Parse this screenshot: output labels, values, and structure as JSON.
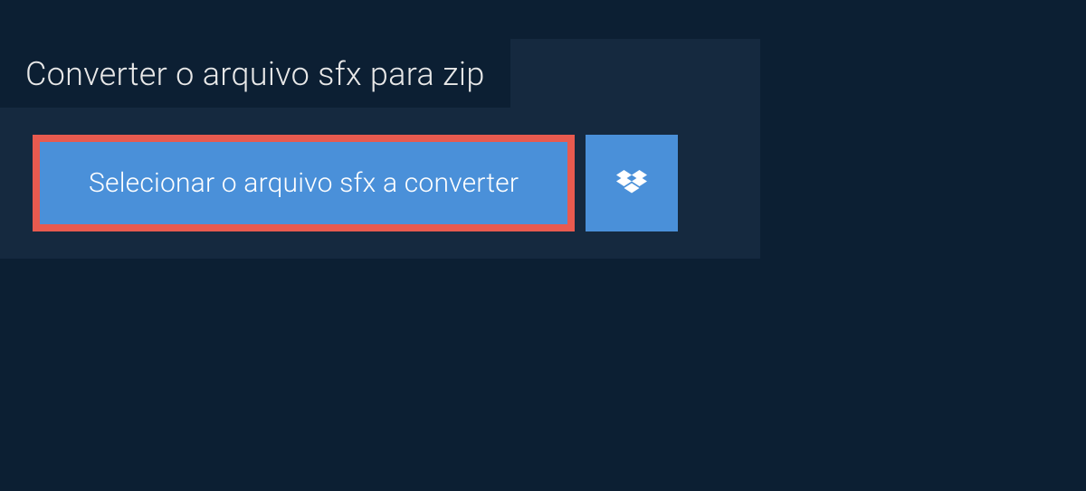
{
  "header": {
    "title": "Converter o arquivo sfx para zip"
  },
  "actions": {
    "select_file_label": "Selecionar o arquivo sfx a converter",
    "dropbox_icon_name": "dropbox"
  },
  "colors": {
    "background": "#0c1f33",
    "panel": "#15293f",
    "button": "#4a90d9",
    "highlight_border": "#e85a4f",
    "text": "#e8e8e8"
  }
}
